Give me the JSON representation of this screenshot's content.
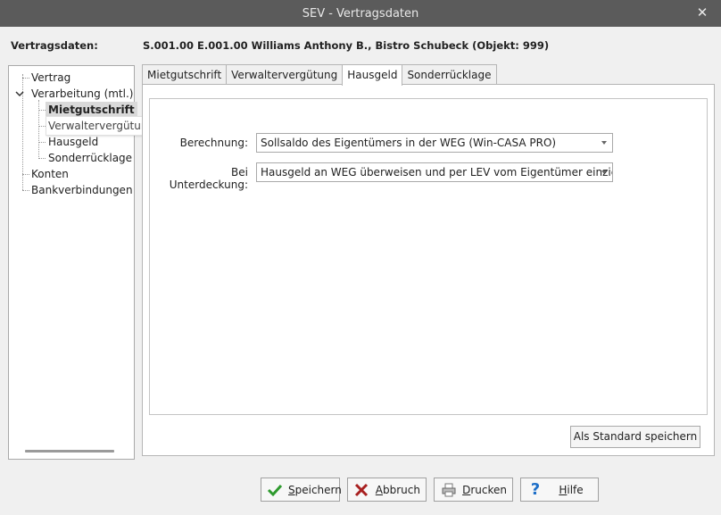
{
  "window": {
    "title": "SEV - Vertragsdaten"
  },
  "sidebar_label": "Vertragsdaten:",
  "header_info": "S.001.00 E.001.00 Williams Anthony B., Bistro Schubeck (Objekt: 999)",
  "tree": {
    "vertrag": "Vertrag",
    "verarbeitung": "Verarbeitung (mtl.)",
    "mietgutschrift": "Mietgutschrift",
    "verwaltervergutung": "Verwaltervergütung",
    "hausgeld": "Hausgeld",
    "sonderrucklage": "Sonderrücklage",
    "konten": "Konten",
    "bankverbindungen": "Bankverbindungen"
  },
  "tabs": [
    "Mietgutschrift",
    "Verwaltervergütung",
    "Hausgeld",
    "Sonderrücklage"
  ],
  "active_tab": "Hausgeld",
  "form": {
    "berechnung_label": "Berechnung:",
    "berechnung_value": "Sollsaldo des Eigentümers in der WEG (Win-CASA PRO)",
    "unterdeckung_label": "Bei Unterdeckung:",
    "unterdeckung_value": "Hausgeld an WEG überweisen und per LEV vom Eigentümer einziehen"
  },
  "standard_button": "Als Standard speichern",
  "buttons": {
    "save_first": "S",
    "save_rest": "peichern",
    "cancel_first": "A",
    "cancel_rest": "bbruch",
    "print_first": "D",
    "print_rest": "rucken",
    "help_first": "H",
    "help_rest": "ilfe"
  },
  "colors": {
    "titlebar": "#5b5b5b",
    "save_icon": "#2e9a2e",
    "cancel_icon": "#a82020",
    "help_icon": "#1e6fc8"
  },
  "icons": {
    "save": "checkmark-icon",
    "cancel": "x-icon",
    "print": "printer-icon",
    "help": "question-icon",
    "close": "close-icon",
    "expand": "chevron-down-icon"
  }
}
